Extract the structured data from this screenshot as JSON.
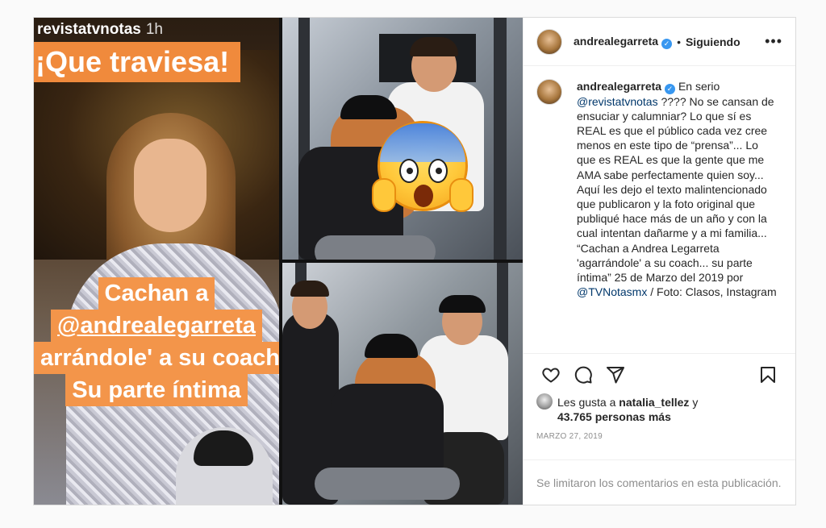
{
  "story": {
    "username": "revistatvnotas",
    "time": "1h",
    "headline": "¡Que traviesa!",
    "caption_lines": [
      "Cachan a",
      "@andrealegarreta",
      "arrándole' a su coach",
      "Su parte íntima"
    ]
  },
  "post": {
    "author": "andrealegarreta",
    "follow_status": "Siguiendo",
    "caption": {
      "author": "andrealegarreta",
      "part1": "En serio",
      "mention1": "@revistatvnotas",
      "part2": "???? No se cansan de ensuciar y calumniar? Lo que sí es REAL es que el público cada vez cree menos en este tipo de “prensa”... Lo que es REAL es que la gente que me AMA sabe perfectamente quien soy... Aquí les dejo el texto malintencionado que publicaron y la foto original que publiqué hace más de un año y con la cual intentan dañarme y a mi familia... “Cachan a Andrea Legarreta 'agarrándole' a su coach... su parte íntima” 25 de Marzo del 2019 por",
      "mention2": "@TVNotasmx",
      "part3": "/ Foto: Clasos, Instagram"
    },
    "likes": {
      "prefix": "Les gusta a",
      "user": "natalia_tellez",
      "mid": "y",
      "count_text": "43.765 personas más"
    },
    "date": "MARZO 27, 2019",
    "comments_disabled": "Se limitaron los comentarios en esta publicación."
  },
  "icons": {
    "like": "heart-icon",
    "comment": "comment-icon",
    "share": "share-icon",
    "save": "bookmark-icon",
    "more": "more-options-icon",
    "verified": "verified-badge-icon"
  },
  "colors": {
    "accent_orange": "#f08a3c",
    "verified_blue": "#3897f0",
    "mention": "#00376b",
    "muted": "#8e8e8e"
  }
}
